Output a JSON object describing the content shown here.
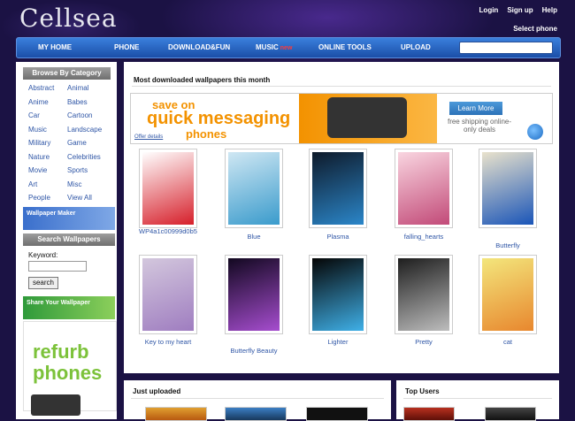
{
  "header": {
    "logo": "Cellsea",
    "top_links": [
      "Login",
      "Sign up",
      "Help"
    ],
    "select_phone": "Select phone"
  },
  "nav": {
    "items": [
      "MY HOME",
      "PHONE",
      "DOWNLOAD&FUN",
      "MUSIC",
      "ONLINE TOOLS",
      "UPLOAD"
    ],
    "music_badge": "new",
    "search_placeholder": ""
  },
  "sidebar": {
    "browse_title": "Browse By Category",
    "categories": [
      "Abstract",
      "Animal",
      "Anime",
      "Babes",
      "Car",
      "Cartoon",
      "Music",
      "Landscape",
      "Military",
      "Game",
      "Nature",
      "Celebrities",
      "Movie",
      "Sports",
      "Art",
      "Misc",
      "People",
      "View All"
    ],
    "wallpaper_maker": "Wallpaper Maker",
    "search_title": "Search Wallpapers",
    "keyword_label": "Keyword:",
    "search_button": "search",
    "share": "Share Your Wallpaper",
    "side_ad_text": "refurb phones"
  },
  "main": {
    "section_title": "Most downloaded wallpapers this month",
    "ad": {
      "line1": "save on",
      "line2": "quick messaging",
      "line3": "phones",
      "offer": "Offer details",
      "learn_more": "Learn More",
      "shipping": "free shipping online-only deals"
    },
    "wallpapers": [
      {
        "label": "WP4a1c00999d0b5",
        "colors": [
          "#ffffff",
          "#d61f2a"
        ]
      },
      {
        "label": "Blue",
        "colors": [
          "#cfe7f3",
          "#3a9bcc"
        ]
      },
      {
        "label": "Plasma",
        "colors": [
          "#0e1a2a",
          "#2b86c9"
        ]
      },
      {
        "label": "falling_hearts",
        "colors": [
          "#f9d5e0",
          "#c24a78"
        ]
      },
      {
        "label": "Butterfly",
        "colors": [
          "#e9e2cc",
          "#1a55b8"
        ]
      },
      {
        "label": "Key to my heart",
        "colors": [
          "#d3c7dd",
          "#9f7dc0"
        ]
      },
      {
        "label": "Butterfly Beauty",
        "colors": [
          "#120820",
          "#a64dcf"
        ]
      },
      {
        "label": "Lighter",
        "colors": [
          "#050505",
          "#3fb0e8"
        ]
      },
      {
        "label": "Pretty",
        "colors": [
          "#1e1e1e",
          "#bdbdbd"
        ]
      },
      {
        "label": "cat",
        "colors": [
          "#f3e67c",
          "#e8872e"
        ]
      }
    ]
  },
  "bottom": {
    "just_uploaded": "Just uploaded",
    "top_users": "Top Users"
  }
}
